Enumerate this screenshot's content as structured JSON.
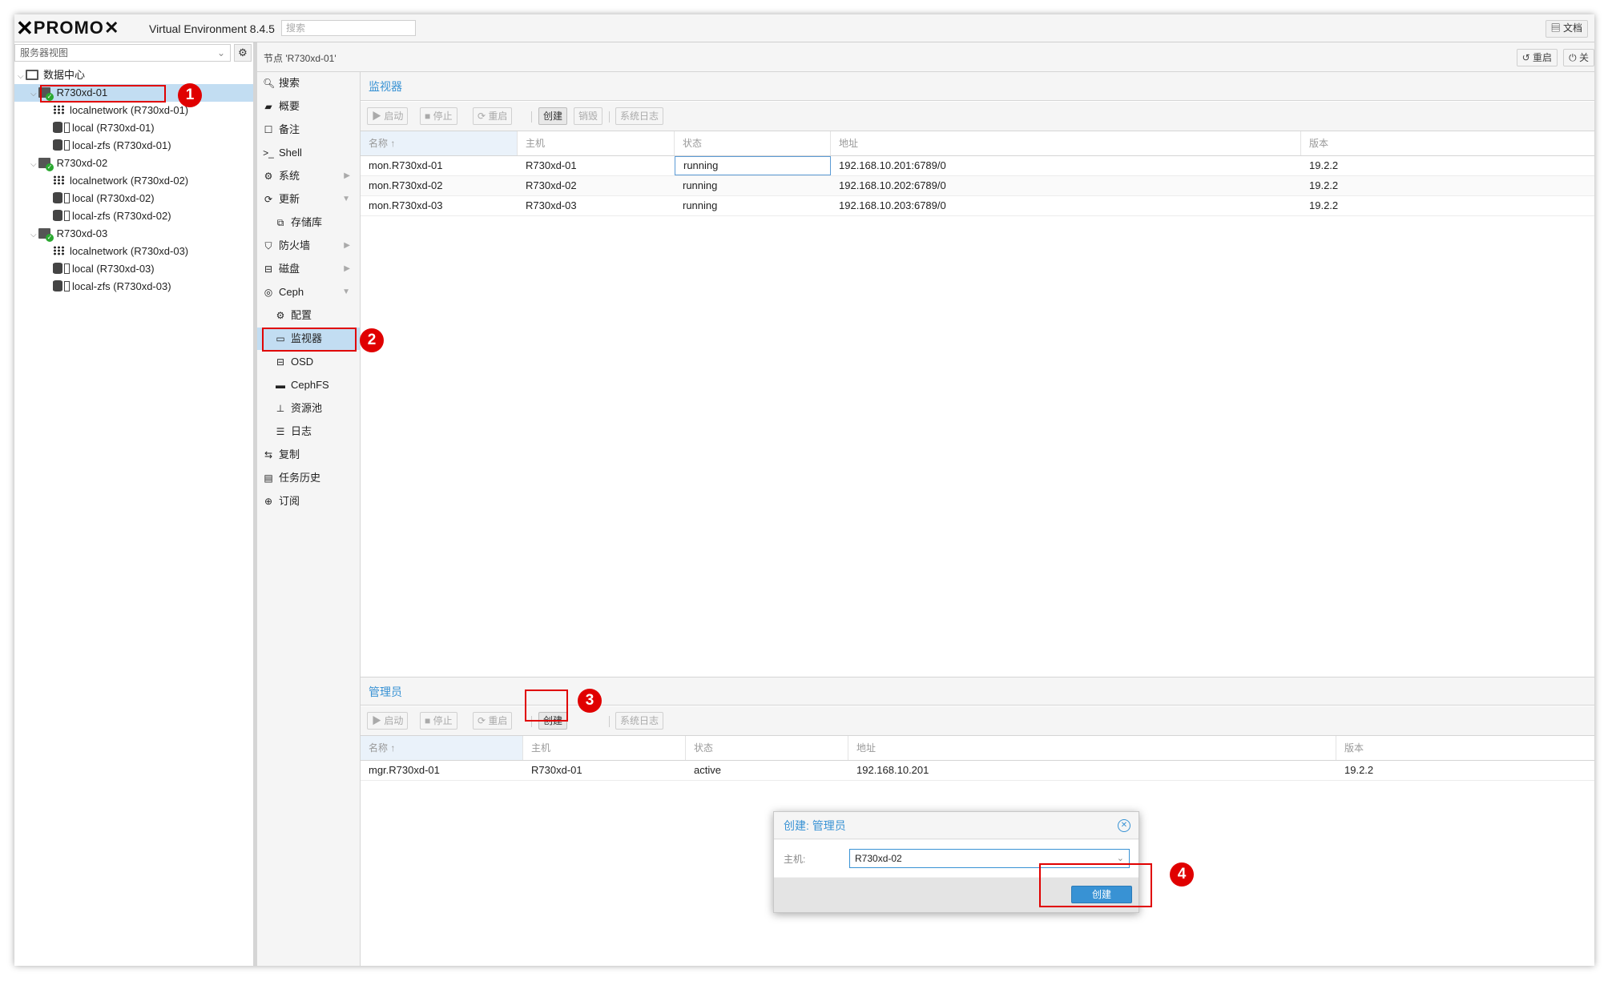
{
  "topbar": {
    "brand_prefix": "PRO",
    "brand_suffix": "MO",
    "version": "Virtual Environment 8.4.5",
    "search_placeholder": "搜索",
    "docs_button": "文档"
  },
  "left": {
    "view_select": "服务器视图",
    "tree": [
      {
        "label": "数据中心",
        "type": "datacenter"
      },
      {
        "label": "R730xd-01",
        "type": "node",
        "selected": true
      },
      {
        "label": "localnetwork (R730xd-01)",
        "type": "network"
      },
      {
        "label": "local (R730xd-01)",
        "type": "storage"
      },
      {
        "label": "local-zfs (R730xd-01)",
        "type": "storage"
      },
      {
        "label": "R730xd-02",
        "type": "node"
      },
      {
        "label": "localnetwork (R730xd-02)",
        "type": "network"
      },
      {
        "label": "local (R730xd-02)",
        "type": "storage"
      },
      {
        "label": "local-zfs (R730xd-02)",
        "type": "storage"
      },
      {
        "label": "R730xd-03",
        "type": "node"
      },
      {
        "label": "localnetwork (R730xd-03)",
        "type": "network"
      },
      {
        "label": "local (R730xd-03)",
        "type": "storage"
      },
      {
        "label": "local-zfs (R730xd-03)",
        "type": "storage"
      }
    ]
  },
  "node_header": {
    "title": "节点 'R730xd-01'",
    "reboot_button": "重启",
    "shutdown_button": "关"
  },
  "menu": [
    {
      "label": "搜索",
      "icon": "search-icon"
    },
    {
      "label": "概要",
      "icon": "book-icon"
    },
    {
      "label": "备注",
      "icon": "note-icon"
    },
    {
      "label": "Shell",
      "icon": "terminal-icon"
    },
    {
      "label": "系统",
      "icon": "gears-icon"
    },
    {
      "label": "更新",
      "icon": "refresh-icon"
    },
    {
      "label": "存储库",
      "icon": "repository-icon"
    },
    {
      "label": "防火墙",
      "icon": "shield-icon"
    },
    {
      "label": "磁盘",
      "icon": "disk-icon"
    },
    {
      "label": "Ceph",
      "icon": "ceph-icon"
    },
    {
      "label": "配置",
      "icon": "gear-icon"
    },
    {
      "label": "监视器",
      "icon": "monitor-icon"
    },
    {
      "label": "OSD",
      "icon": "disk-icon"
    },
    {
      "label": "CephFS",
      "icon": "folder-icon"
    },
    {
      "label": "资源池",
      "icon": "sitemap-icon"
    },
    {
      "label": "日志",
      "icon": "list-icon"
    },
    {
      "label": "复制",
      "icon": "retweet-icon"
    },
    {
      "label": "任务历史",
      "icon": "list-alt-icon"
    },
    {
      "label": "订阅",
      "icon": "support-icon"
    }
  ],
  "monitors": {
    "title": "监视器",
    "toolbar": {
      "start": "启动",
      "stop": "停止",
      "restart": "重启",
      "create": "创建",
      "destroy": "销毁",
      "syslog": "系统日志"
    },
    "columns": [
      "名称 ↑",
      "主机",
      "状态",
      "地址",
      "版本"
    ],
    "rows": [
      [
        "mon.R730xd-01",
        "R730xd-01",
        "running",
        "192.168.10.201:6789/0",
        "19.2.2"
      ],
      [
        "mon.R730xd-02",
        "R730xd-02",
        "running",
        "192.168.10.202:6789/0",
        "19.2.2"
      ],
      [
        "mon.R730xd-03",
        "R730xd-03",
        "running",
        "192.168.10.203:6789/0",
        "19.2.2"
      ]
    ]
  },
  "managers": {
    "title": "管理员",
    "toolbar": {
      "start": "启动",
      "stop": "停止",
      "restart": "重启",
      "create": "创建",
      "syslog": "系统日志"
    },
    "columns": [
      "名称 ↑",
      "主机",
      "状态",
      "地址",
      "版本"
    ],
    "rows": [
      [
        "mgr.R730xd-01",
        "R730xd-01",
        "active",
        "192.168.10.201",
        "19.2.2"
      ]
    ]
  },
  "dialog": {
    "title": "创建: 管理员",
    "host_label": "主机:",
    "host_value": "R730xd-02",
    "create_button": "创建"
  },
  "annotations": [
    "1",
    "2",
    "3",
    "4"
  ],
  "colors": {
    "accent": "#3892d4",
    "selection": "#c2ddf2",
    "annotation": "#e00000",
    "brand_orange": "#e57000"
  }
}
